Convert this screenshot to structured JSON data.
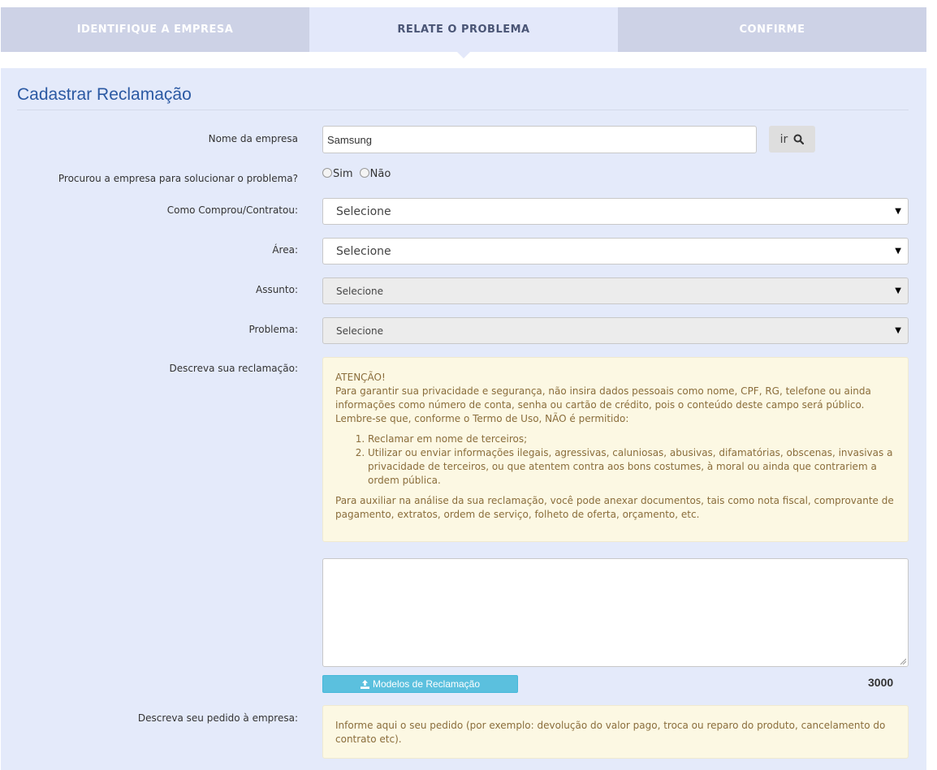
{
  "steps": [
    {
      "label": "IDENTIFIQUE A EMPRESA"
    },
    {
      "label": "RELATE O PROBLEMA"
    },
    {
      "label": "CONFIRME"
    }
  ],
  "form": {
    "title": "Cadastrar Reclamação",
    "company": {
      "label": "Nome da empresa",
      "value": "Samsung",
      "button_label": "ir"
    },
    "contacted": {
      "label": "Procurou a empresa para solucionar o problema?",
      "option_yes": "Sim",
      "option_no": "Não"
    },
    "how_bought": {
      "label": "Como Comprou/Contratou:",
      "selected": "Selecione"
    },
    "area": {
      "label": "Área:",
      "selected": "Selecione"
    },
    "subject": {
      "label": "Assunto:",
      "selected": "Selecione"
    },
    "problem": {
      "label": "Problema:",
      "selected": "Selecione"
    },
    "describe": {
      "label": "Descreva sua reclamação:",
      "notice_title": "ATENÇÃO!",
      "notice_text": "Para garantir sua privacidade e segurança, não insira dados pessoais como nome, CPF, RG, telefone ou ainda informações como número de conta, senha ou cartão de crédito, pois o conteúdo deste campo será público. Lembre-se que, conforme o Termo de Uso, NÃO é permitido:",
      "rules": [
        "Reclamar em nome de terceiros;",
        "Utilizar ou enviar informações ilegais, agressivas, caluniosas, abusivas, difamatórias, obscenas, invasivas a privacidade de terceiros, ou que atentem contra aos bons costumes, à moral ou ainda que contrariem a ordem pública."
      ],
      "notice_footer": "Para auxiliar na análise da sua reclamação, você pode anexar documentos, tais como nota fiscal, comprovante de pagamento, extratos, ordem de serviço, folheto de oferta, orçamento, etc.",
      "textarea_value": "",
      "models_button": "Modelos de Reclamação",
      "char_counter": "3000"
    },
    "request": {
      "label": "Descreva seu pedido à empresa:",
      "notice_text": "Informe aqui o seu pedido (por exemplo: devolução do valor pago, troca ou reparo do produto, cancelamento do contrato etc)."
    }
  }
}
